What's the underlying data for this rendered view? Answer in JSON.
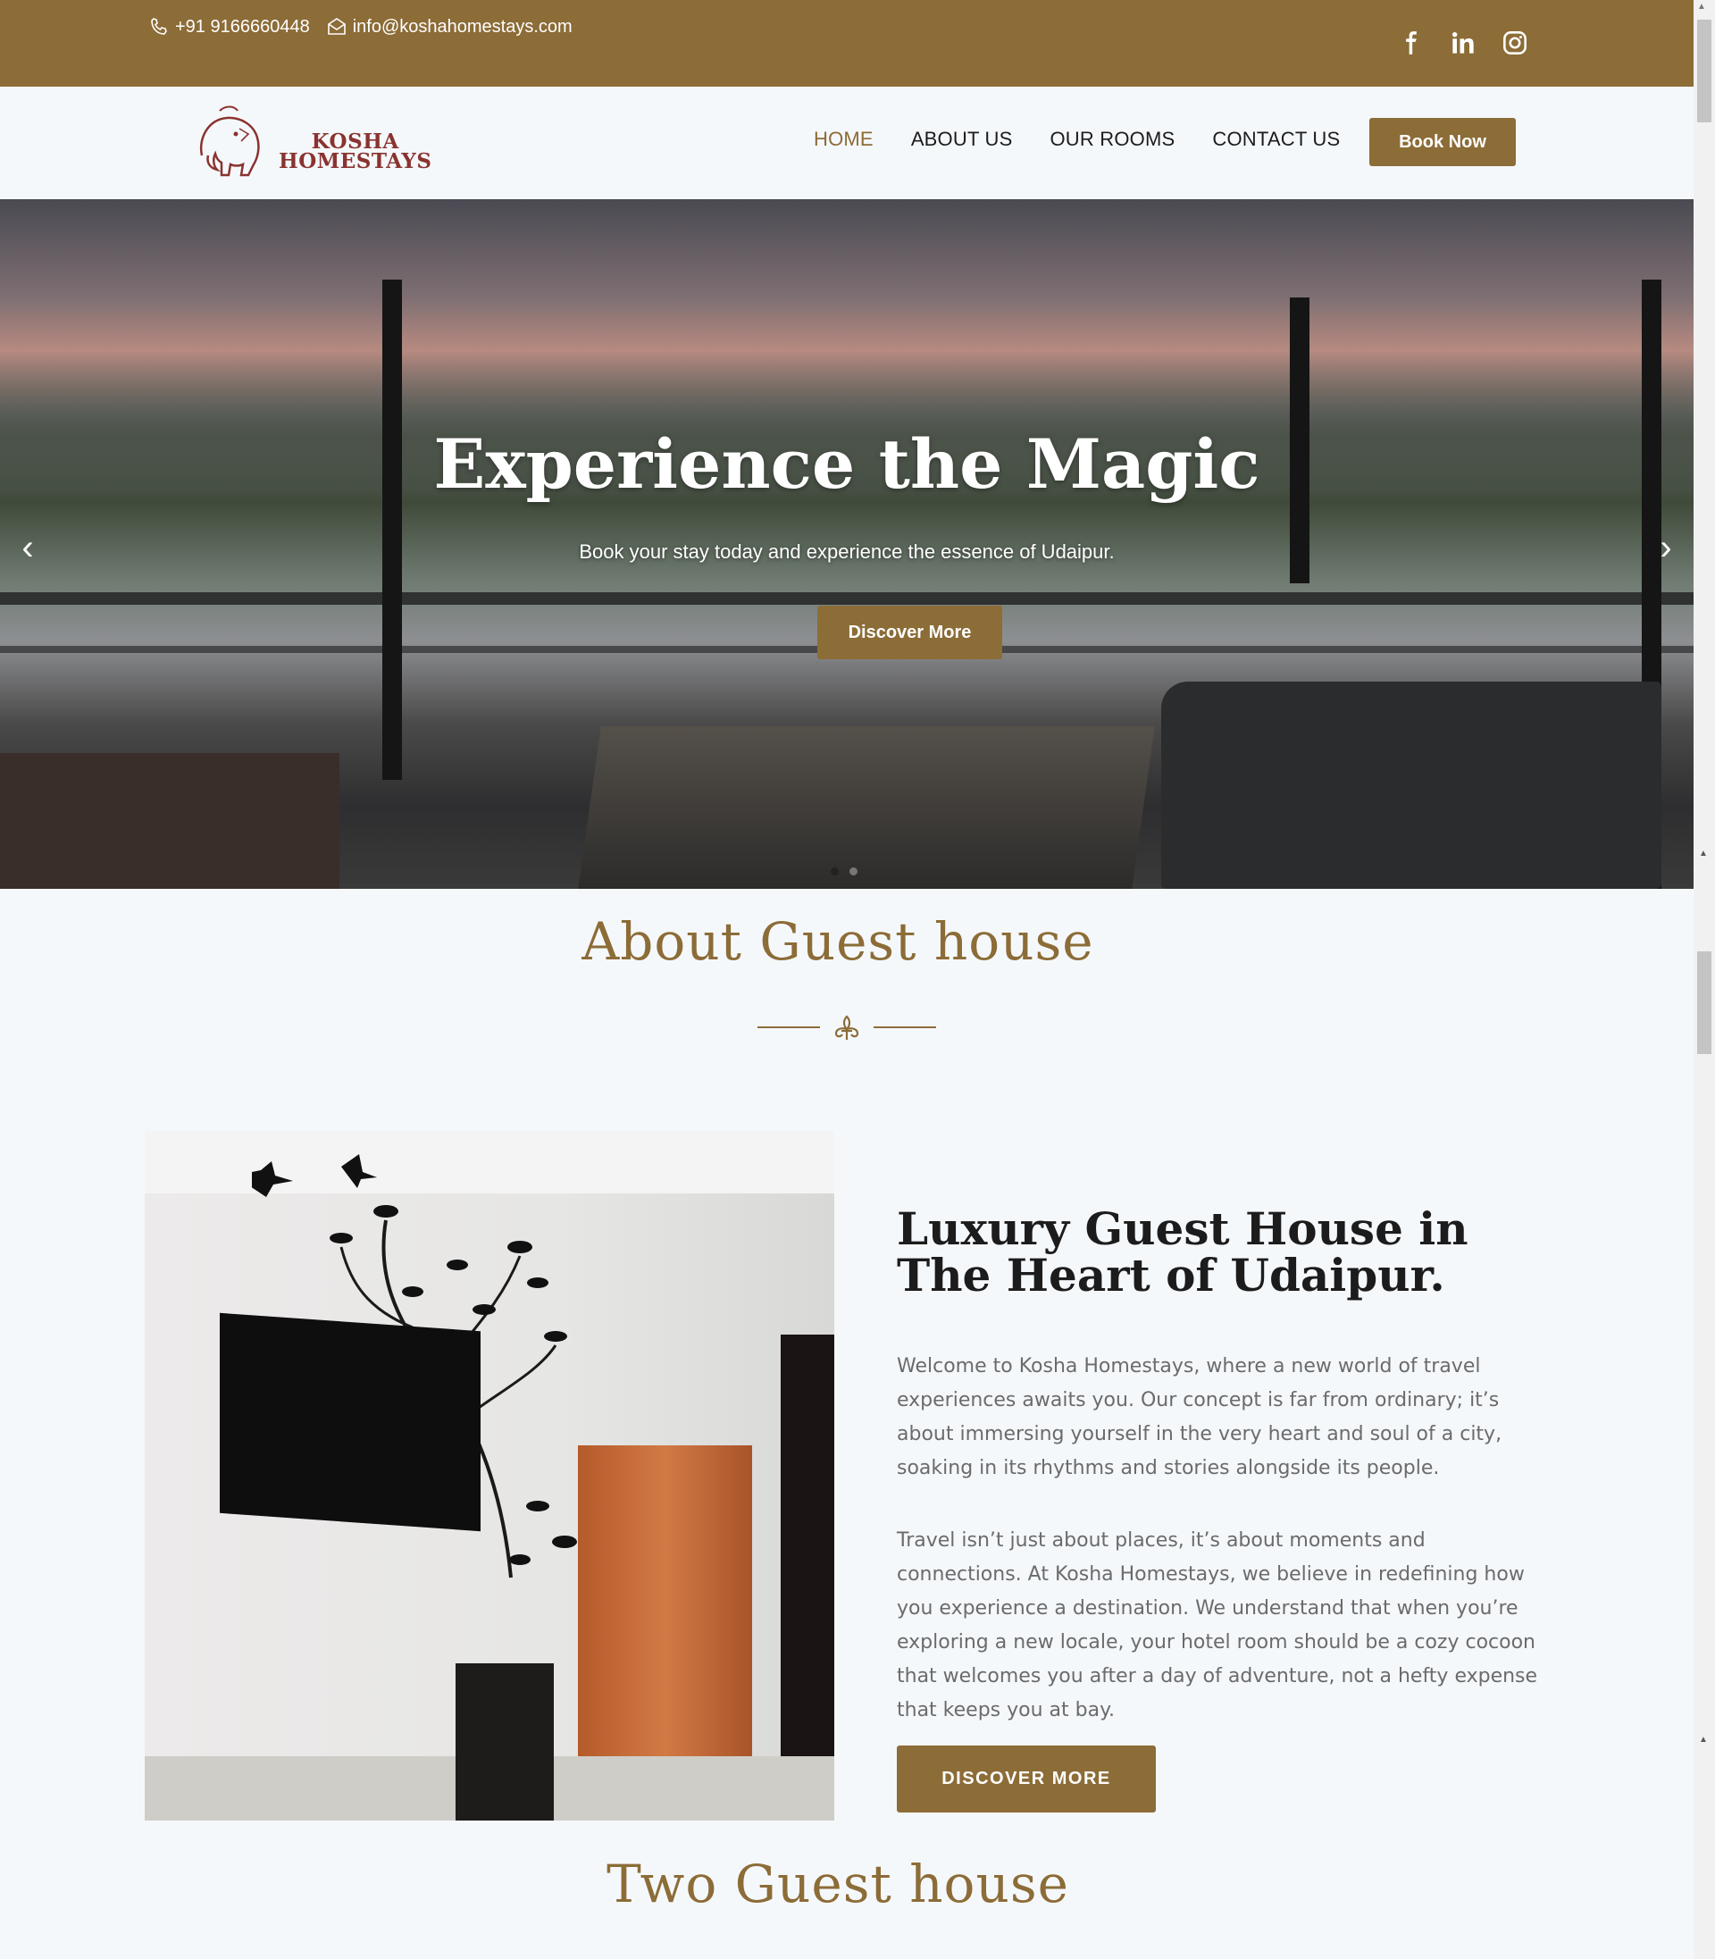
{
  "topbar": {
    "phone": "+91 9166660448",
    "email": "info@koshahomestays.com",
    "social": [
      "facebook-icon",
      "linkedin-icon",
      "instagram-icon"
    ]
  },
  "nav": {
    "logo_line1": "KOSHA",
    "logo_line2": "HOMESTAYS",
    "items": [
      {
        "label": "HOME",
        "active": true
      },
      {
        "label": "ABOUT US",
        "active": false
      },
      {
        "label": "OUR ROOMS",
        "active": false
      },
      {
        "label": "CONTACT US",
        "active": false
      }
    ],
    "book_label": "Book Now"
  },
  "hero": {
    "title": "Experience the Magic",
    "subtitle": "Book your stay today and experience the essence of Udaipur.",
    "cta": "Discover More",
    "slides": 2,
    "active_slide": 1
  },
  "about": {
    "section_title": "About Guest house",
    "heading": "Luxury Guest House in The Heart of Udaipur.",
    "para1": "Welcome to Kosha Homestays, where a new world of travel experiences awaits you. Our concept is far from ordinary; it’s about immersing yourself in the very heart and soul of a city, soaking in its rhythms and stories alongside its people.",
    "para2": "Travel isn’t just about places, it’s about moments and connections. At Kosha Homestays, we believe in redefining how you experience a destination. We understand that when you’re exploring a new locale, your hotel room should be a cozy cocoon that welcomes you after a day of adventure, not a hefty expense that keeps you at bay.",
    "button": "DISCOVER MORE"
  },
  "next_section": {
    "title": "Two Guest house"
  },
  "colors": {
    "brand": "#8c6c37",
    "logo": "#8a3330",
    "text": "#1c1c1c",
    "muted": "#6b6b6b",
    "background": "#f5f8fb"
  }
}
